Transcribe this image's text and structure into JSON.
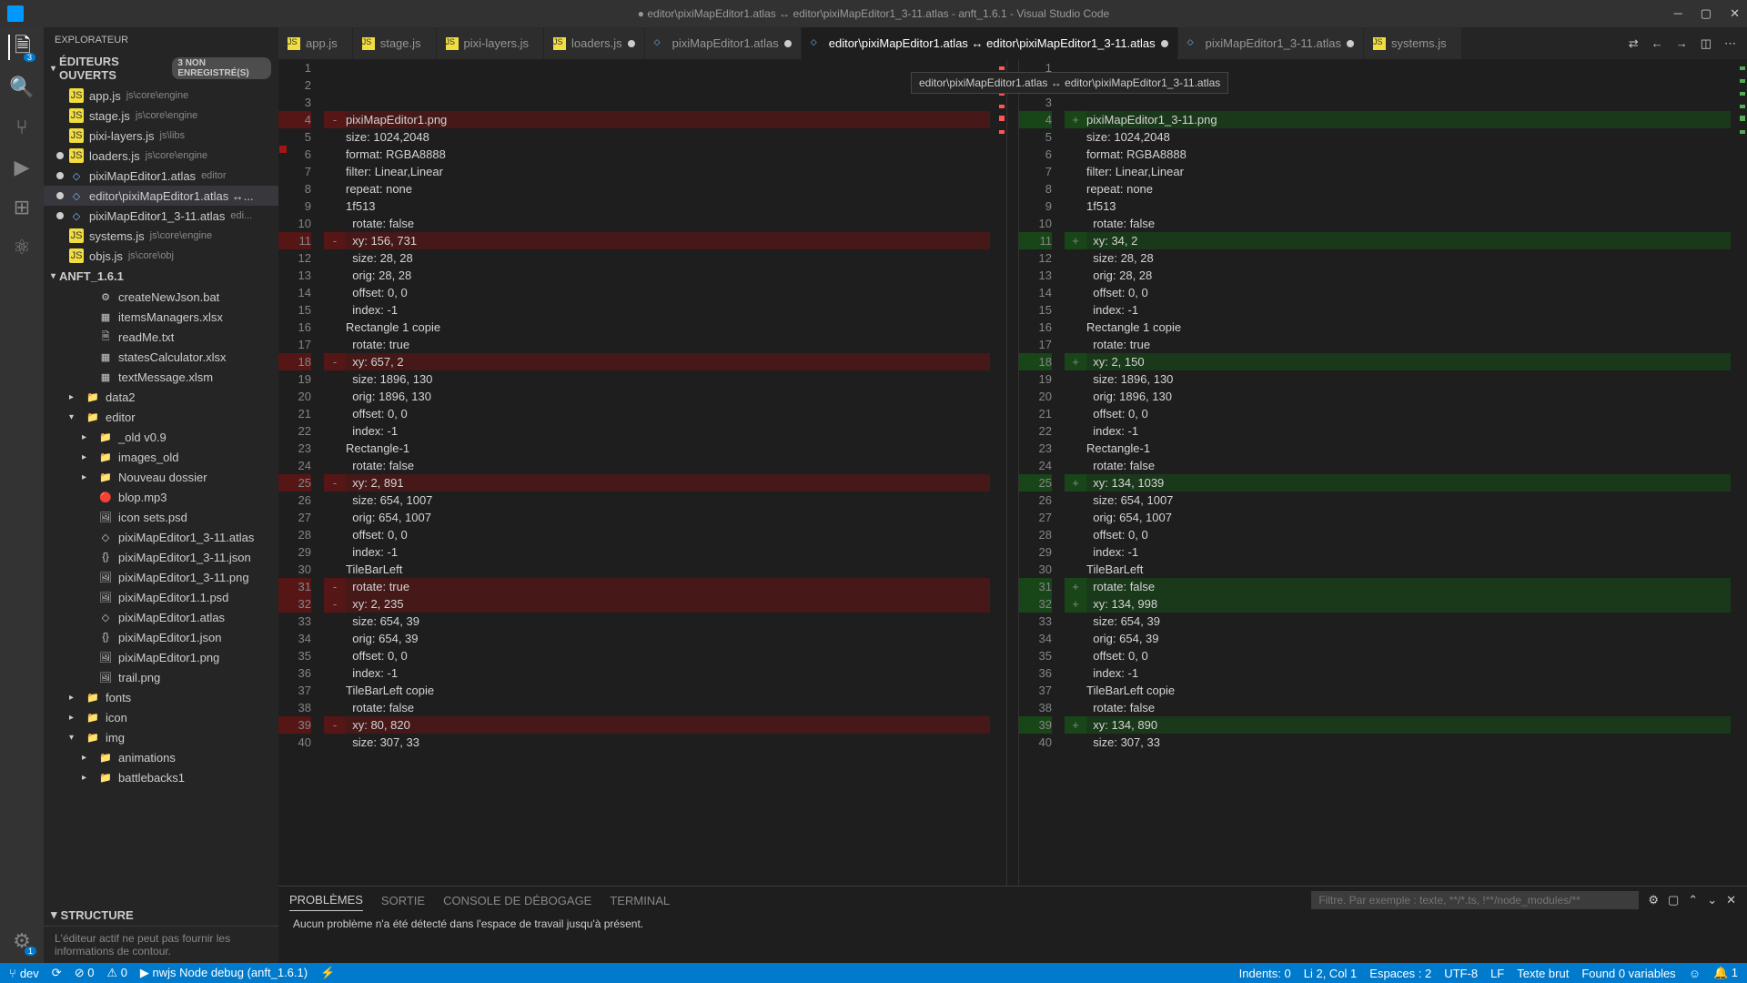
{
  "title": "● editor\\pixiMapEditor1.atlas ↔ editor\\pixiMapEditor1_3-11.atlas - anft_1.6.1 - Visual Studio Code",
  "tooltip": "editor\\pixiMapEditor1.atlas ↔ editor\\pixiMapEditor1_3-11.atlas",
  "sidebar": {
    "title": "EXPLORATEUR",
    "openEditors": {
      "label": "ÉDITEURS OUVERTS",
      "badge": "3 NON ENREGISTRÉ(S)"
    },
    "openItems": [
      {
        "name": "app.js",
        "path": "js\\core\\engine",
        "icon": "JS",
        "dirty": false
      },
      {
        "name": "stage.js",
        "path": "js\\core\\engine",
        "icon": "JS",
        "dirty": false
      },
      {
        "name": "pixi-layers.js",
        "path": "js\\libs",
        "icon": "JS",
        "dirty": false
      },
      {
        "name": "loaders.js",
        "path": "js\\core\\engine",
        "icon": "JS",
        "dirty": true
      },
      {
        "name": "pixiMapEditor1.atlas",
        "path": "editor",
        "icon": "F",
        "dirty": true
      },
      {
        "name": "editor\\pixiMapEditor1.atlas ↔...",
        "path": "",
        "icon": "F",
        "dirty": true,
        "active": true
      },
      {
        "name": "pixiMapEditor1_3-11.atlas",
        "path": "edi...",
        "icon": "F",
        "dirty": true
      },
      {
        "name": "systems.js",
        "path": "js\\core\\engine",
        "icon": "JS",
        "dirty": false
      },
      {
        "name": "objs.js",
        "path": "js\\core\\obj",
        "icon": "JS",
        "dirty": false
      }
    ],
    "projectName": "ANFT_1.6.1",
    "tree": [
      {
        "name": "createNewJson.bat",
        "icon": "bat",
        "depth": 2
      },
      {
        "name": "itemsManagers.xlsx",
        "icon": "xls",
        "depth": 2
      },
      {
        "name": "readMe.txt",
        "icon": "txt",
        "depth": 2
      },
      {
        "name": "statesCalculator.xlsx",
        "icon": "xls",
        "depth": 2
      },
      {
        "name": "textMessage.xlsm",
        "icon": "xls",
        "depth": 2
      },
      {
        "name": "data2",
        "icon": "folder",
        "depth": 1,
        "chev": "▸"
      },
      {
        "name": "editor",
        "icon": "folder",
        "depth": 1,
        "chev": "▾"
      },
      {
        "name": "_old v0.9",
        "icon": "folder",
        "depth": 2,
        "chev": "▸"
      },
      {
        "name": "images_old",
        "icon": "folder",
        "depth": 2,
        "chev": "▸"
      },
      {
        "name": "Nouveau dossier",
        "icon": "folder",
        "depth": 2,
        "chev": "▸"
      },
      {
        "name": "blop.mp3",
        "icon": "audio",
        "depth": 2
      },
      {
        "name": "icon sets.psd",
        "icon": "img",
        "depth": 2
      },
      {
        "name": "pixiMapEditor1_3-11.atlas",
        "icon": "file",
        "depth": 2
      },
      {
        "name": "pixiMapEditor1_3-11.json",
        "icon": "json",
        "depth": 2
      },
      {
        "name": "pixiMapEditor1_3-11.png",
        "icon": "img",
        "depth": 2
      },
      {
        "name": "pixiMapEditor1.1.psd",
        "icon": "img",
        "depth": 2
      },
      {
        "name": "pixiMapEditor1.atlas",
        "icon": "file",
        "depth": 2
      },
      {
        "name": "pixiMapEditor1.json",
        "icon": "json",
        "depth": 2
      },
      {
        "name": "pixiMapEditor1.png",
        "icon": "img",
        "depth": 2
      },
      {
        "name": "trail.png",
        "icon": "img",
        "depth": 2
      },
      {
        "name": "fonts",
        "icon": "folderc",
        "depth": 1,
        "chev": "▸"
      },
      {
        "name": "icon",
        "icon": "folderc",
        "depth": 1,
        "chev": "▸"
      },
      {
        "name": "img",
        "icon": "folderc",
        "depth": 1,
        "chev": "▾"
      },
      {
        "name": "animations",
        "icon": "folderc",
        "depth": 2,
        "chev": "▸"
      },
      {
        "name": "battlebacks1",
        "icon": "folderc",
        "depth": 2,
        "chev": "▸"
      }
    ],
    "structure": {
      "label": "STRUCTURE",
      "msg": "L'éditeur actif ne peut pas fournir les informations de contour."
    }
  },
  "tabs": [
    {
      "label": "app.js",
      "icon": "JS"
    },
    {
      "label": "stage.js",
      "icon": "JS"
    },
    {
      "label": "pixi-layers.js",
      "icon": "JS"
    },
    {
      "label": "loaders.js",
      "icon": "JS",
      "dirty": true
    },
    {
      "label": "pixiMapEditor1.atlas",
      "icon": "F",
      "dirty": true
    },
    {
      "label": "editor\\pixiMapEditor1.atlas ↔ editor\\pixiMapEditor1_3-11.atlas",
      "icon": "F",
      "dirty": true,
      "active": true
    },
    {
      "label": "pixiMapEditor1_3-11.atlas",
      "icon": "F",
      "dirty": true
    },
    {
      "label": "systems.js",
      "icon": "JS"
    }
  ],
  "diff": {
    "left": [
      {
        "n": 1,
        "t": ""
      },
      {
        "n": 2,
        "t": ""
      },
      {
        "n": 3,
        "t": ""
      },
      {
        "n": 4,
        "t": "pixiMapEditor1.png",
        "m": "-",
        "cls": "removed"
      },
      {
        "n": 5,
        "t": "size: 1024,2048"
      },
      {
        "n": 6,
        "t": "format: RGBA8888"
      },
      {
        "n": 7,
        "t": "filter: Linear,Linear"
      },
      {
        "n": 8,
        "t": "repeat: none"
      },
      {
        "n": 9,
        "t": "1f513"
      },
      {
        "n": 10,
        "t": "  rotate: false"
      },
      {
        "n": 11,
        "t": "  xy: 156, 731",
        "m": "-",
        "cls": "removed"
      },
      {
        "n": 12,
        "t": "  size: 28, 28"
      },
      {
        "n": 13,
        "t": "  orig: 28, 28"
      },
      {
        "n": 14,
        "t": "  offset: 0, 0"
      },
      {
        "n": 15,
        "t": "  index: -1"
      },
      {
        "n": 16,
        "t": "Rectangle 1 copie"
      },
      {
        "n": 17,
        "t": "  rotate: true"
      },
      {
        "n": 18,
        "t": "  xy: 657, 2",
        "m": "-",
        "cls": "removed"
      },
      {
        "n": 19,
        "t": "  size: 1896, 130"
      },
      {
        "n": 20,
        "t": "  orig: 1896, 130"
      },
      {
        "n": 21,
        "t": "  offset: 0, 0"
      },
      {
        "n": 22,
        "t": "  index: -1"
      },
      {
        "n": 23,
        "t": "Rectangle-1"
      },
      {
        "n": 24,
        "t": "  rotate: false"
      },
      {
        "n": 25,
        "t": "  xy: 2, 891",
        "m": "-",
        "cls": "removed"
      },
      {
        "n": 26,
        "t": "  size: 654, 1007"
      },
      {
        "n": 27,
        "t": "  orig: 654, 1007"
      },
      {
        "n": 28,
        "t": "  offset: 0, 0"
      },
      {
        "n": 29,
        "t": "  index: -1"
      },
      {
        "n": 30,
        "t": "TileBarLeft"
      },
      {
        "n": 31,
        "t": "  rotate: true",
        "m": "-",
        "cls": "removed"
      },
      {
        "n": 32,
        "t": "  xy: 2, 235",
        "m": "-",
        "cls": "removed"
      },
      {
        "n": 33,
        "t": "  size: 654, 39"
      },
      {
        "n": 34,
        "t": "  orig: 654, 39"
      },
      {
        "n": 35,
        "t": "  offset: 0, 0"
      },
      {
        "n": 36,
        "t": "  index: -1"
      },
      {
        "n": 37,
        "t": "TileBarLeft copie"
      },
      {
        "n": 38,
        "t": "  rotate: false"
      },
      {
        "n": 39,
        "t": "  xy: 80, 820",
        "m": "-",
        "cls": "removed"
      },
      {
        "n": 40,
        "t": "  size: 307, 33"
      }
    ],
    "right": [
      {
        "n": 1,
        "t": ""
      },
      {
        "n": 2,
        "t": ""
      },
      {
        "n": 3,
        "t": ""
      },
      {
        "n": 4,
        "t": "pixiMapEditor1_3-11.png",
        "m": "+",
        "cls": "added"
      },
      {
        "n": 5,
        "t": "size: 1024,2048"
      },
      {
        "n": 6,
        "t": "format: RGBA8888"
      },
      {
        "n": 7,
        "t": "filter: Linear,Linear"
      },
      {
        "n": 8,
        "t": "repeat: none"
      },
      {
        "n": 9,
        "t": "1f513"
      },
      {
        "n": 10,
        "t": "  rotate: false"
      },
      {
        "n": 11,
        "t": "  xy: 34, 2",
        "m": "+",
        "cls": "added"
      },
      {
        "n": 12,
        "t": "  size: 28, 28"
      },
      {
        "n": 13,
        "t": "  orig: 28, 28"
      },
      {
        "n": 14,
        "t": "  offset: 0, 0"
      },
      {
        "n": 15,
        "t": "  index: -1"
      },
      {
        "n": 16,
        "t": "Rectangle 1 copie"
      },
      {
        "n": 17,
        "t": "  rotate: true"
      },
      {
        "n": 18,
        "t": "  xy: 2, 150",
        "m": "+",
        "cls": "added"
      },
      {
        "n": 19,
        "t": "  size: 1896, 130"
      },
      {
        "n": 20,
        "t": "  orig: 1896, 130"
      },
      {
        "n": 21,
        "t": "  offset: 0, 0"
      },
      {
        "n": 22,
        "t": "  index: -1"
      },
      {
        "n": 23,
        "t": "Rectangle-1"
      },
      {
        "n": 24,
        "t": "  rotate: false"
      },
      {
        "n": 25,
        "t": "  xy: 134, 1039",
        "m": "+",
        "cls": "added"
      },
      {
        "n": 26,
        "t": "  size: 654, 1007"
      },
      {
        "n": 27,
        "t": "  orig: 654, 1007"
      },
      {
        "n": 28,
        "t": "  offset: 0, 0"
      },
      {
        "n": 29,
        "t": "  index: -1"
      },
      {
        "n": 30,
        "t": "TileBarLeft"
      },
      {
        "n": 31,
        "t": "  rotate: false",
        "m": "+",
        "cls": "added"
      },
      {
        "n": 32,
        "t": "  xy: 134, 998",
        "m": "+",
        "cls": "added"
      },
      {
        "n": 33,
        "t": "  size: 654, 39"
      },
      {
        "n": 34,
        "t": "  orig: 654, 39"
      },
      {
        "n": 35,
        "t": "  offset: 0, 0"
      },
      {
        "n": 36,
        "t": "  index: -1"
      },
      {
        "n": 37,
        "t": "TileBarLeft copie"
      },
      {
        "n": 38,
        "t": "  rotate: false"
      },
      {
        "n": 39,
        "t": "  xy: 134, 890",
        "m": "+",
        "cls": "added"
      },
      {
        "n": 40,
        "t": "  size: 307, 33"
      }
    ]
  },
  "panel": {
    "tabs": [
      "PROBLÈMES",
      "SORTIE",
      "CONSOLE DE DÉBOGAGE",
      "TERMINAL"
    ],
    "filterPlaceholder": "Filtre. Par exemple : texte, **/*.ts, !**/node_modules/**",
    "msg": "Aucun problème n'a été détecté dans l'espace de travail jusqu'à présent."
  },
  "status": {
    "branch": "dev",
    "sync": "⟳",
    "errors": "⊘ 0",
    "warnings": "⚠ 0",
    "debug": "▶ nwjs Node debug (anft_1.6.1)",
    "indents": "Indents: 0",
    "lncol": "Li 2, Col 1",
    "spaces": "Espaces : 2",
    "encoding": "UTF-8",
    "eol": "LF",
    "lang": "Texte brut",
    "found": "Found 0 variables",
    "bell": "🔔 1"
  }
}
